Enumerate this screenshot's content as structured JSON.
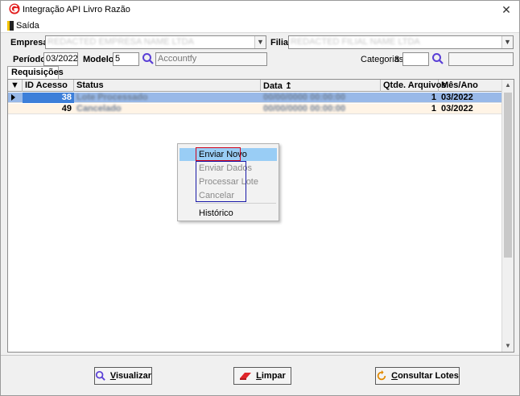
{
  "window": {
    "title": "Integração API Livro Razão",
    "close_glyph": "✕"
  },
  "menu": {
    "exit_label": "Saída",
    "exit_icon": "door-exit-icon"
  },
  "filters": {
    "empresa_label": "Empresa",
    "empresa_value": "REDACTED EMPRESA NAME LTDA",
    "filial_label": "Filial",
    "filial_value": "REDACTED FILIAL NAME LTDA",
    "periodo_label": "Período",
    "periodo_value": "03/2022",
    "modelo_label": "Modelo",
    "modelo_value": "5",
    "modelo_desc": "Accountfy",
    "categorias_label": "Categorias",
    "categorias_value": "8",
    "categorias_desc": ""
  },
  "tab": {
    "label": "Requisições"
  },
  "grid": {
    "columns": [
      "ID Acesso",
      "Status",
      "Data ↥",
      "Qtde. Arquivos",
      "Mês/Ano"
    ],
    "rows": [
      {
        "id": "38",
        "status": "Lote Processado",
        "data": "00/00/0000 00:00:00",
        "qtde": "1",
        "mes_ano": "03/2022",
        "selected": true
      },
      {
        "id": "49",
        "status": "Cancelado",
        "data": "00/00/0000 00:00:00",
        "qtde": "1",
        "mes_ano": "03/2022",
        "selected": false
      }
    ]
  },
  "context_menu": {
    "items": [
      {
        "label": "Enviar Novo",
        "enabled": true
      },
      {
        "label": "Enviar Dados",
        "enabled": false
      },
      {
        "label": "Processar Lote",
        "enabled": false
      },
      {
        "label": "Cancelar",
        "enabled": false
      },
      {
        "label": "Histórico",
        "enabled": true
      }
    ],
    "highlight_color": "#99cdf5",
    "annotation_red": "#d0021b",
    "annotation_blue": "#1a1aa8"
  },
  "buttons": {
    "visualizar": {
      "first": "V",
      "rest": "isualizar",
      "icon": "magnifier-icon"
    },
    "limpar": {
      "first": "L",
      "rest": "impar",
      "icon": "eraser-icon"
    },
    "consultar": {
      "first": "C",
      "rest": "onsultar Lotes",
      "icon": "refresh-icon"
    }
  },
  "colors": {
    "selected_row": "#99b9e8",
    "alt_row": "#fff4e6",
    "accent_search": "#5a3fd6"
  }
}
